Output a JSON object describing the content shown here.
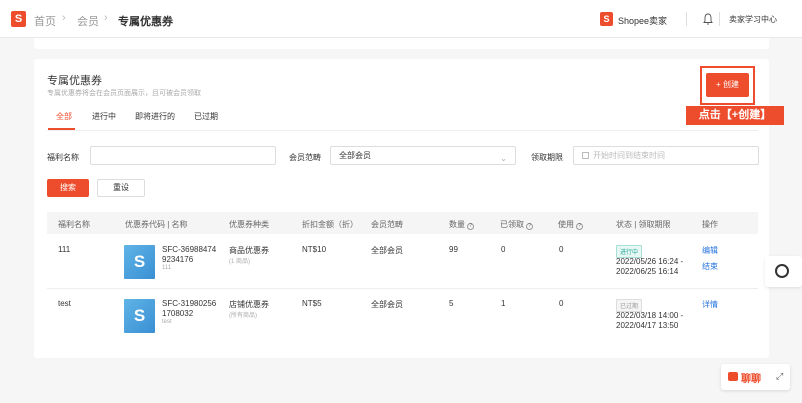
{
  "header": {
    "logo_letter": "S",
    "breadcrumb": [
      "首页",
      "会员",
      "专属优惠券"
    ],
    "separator": "›",
    "brand_logo_letter": "S",
    "brand": "Shopee卖家",
    "learn_center": "卖家学习中心"
  },
  "card": {
    "title": "专属优惠券",
    "subtitle": "专属优惠券将会在会员页面展示，且可被会员领取",
    "create_button": "+ 创建",
    "callout": "点击【+创建】"
  },
  "tabs": [
    "全部",
    "进行中",
    "即将进行的",
    "已过期"
  ],
  "filters": {
    "name_label": "福利名称",
    "name_value": "",
    "scope_label": "会员范畴",
    "scope_value": "全部会员",
    "period_label": "领取期限",
    "period_placeholder": "开始时间到结束时间"
  },
  "actions": {
    "search": "搜索",
    "reset": "重设"
  },
  "table": {
    "headers": [
      "福利名称",
      "优惠券代码 | 名称",
      "优惠券种类",
      "折扣金额（折）",
      "会员范畴",
      "数量",
      "已领取",
      "使用",
      "状态 | 领取期限",
      "操作"
    ],
    "rows": [
      {
        "name": "111",
        "code_line1": "SFC-36988474",
        "code_line2": "9234176",
        "code_name": "111",
        "type": "商品优惠券",
        "type_sub": "(1 商品)",
        "discount": "NT$10",
        "scope": "全部会员",
        "quantity": "99",
        "claimed": "0",
        "used": "0",
        "status": "进行中",
        "period_start": "2022/05/26 16:24 -",
        "period_end": "2022/06/25 16:14",
        "action1": "编辑",
        "action2": "结束"
      },
      {
        "name": "test",
        "code_line1": "SFC-31980256",
        "code_line2": "1708032",
        "code_name": "test",
        "type": "店铺优惠券",
        "type_sub": "(所有商品)",
        "discount": "NT$5",
        "scope": "全部会员",
        "quantity": "5",
        "claimed": "1",
        "used": "0",
        "status": "已过期",
        "period_start": "2022/03/18 14:00 -",
        "period_end": "2022/04/17 13:50",
        "action1": "详情"
      }
    ]
  },
  "coupon_icon_glyph": "S",
  "chat": {
    "label": "聊聊"
  },
  "colors": {
    "primary": "#ee4d2d",
    "link": "#2673dd",
    "ongoing": "#26aa99"
  }
}
